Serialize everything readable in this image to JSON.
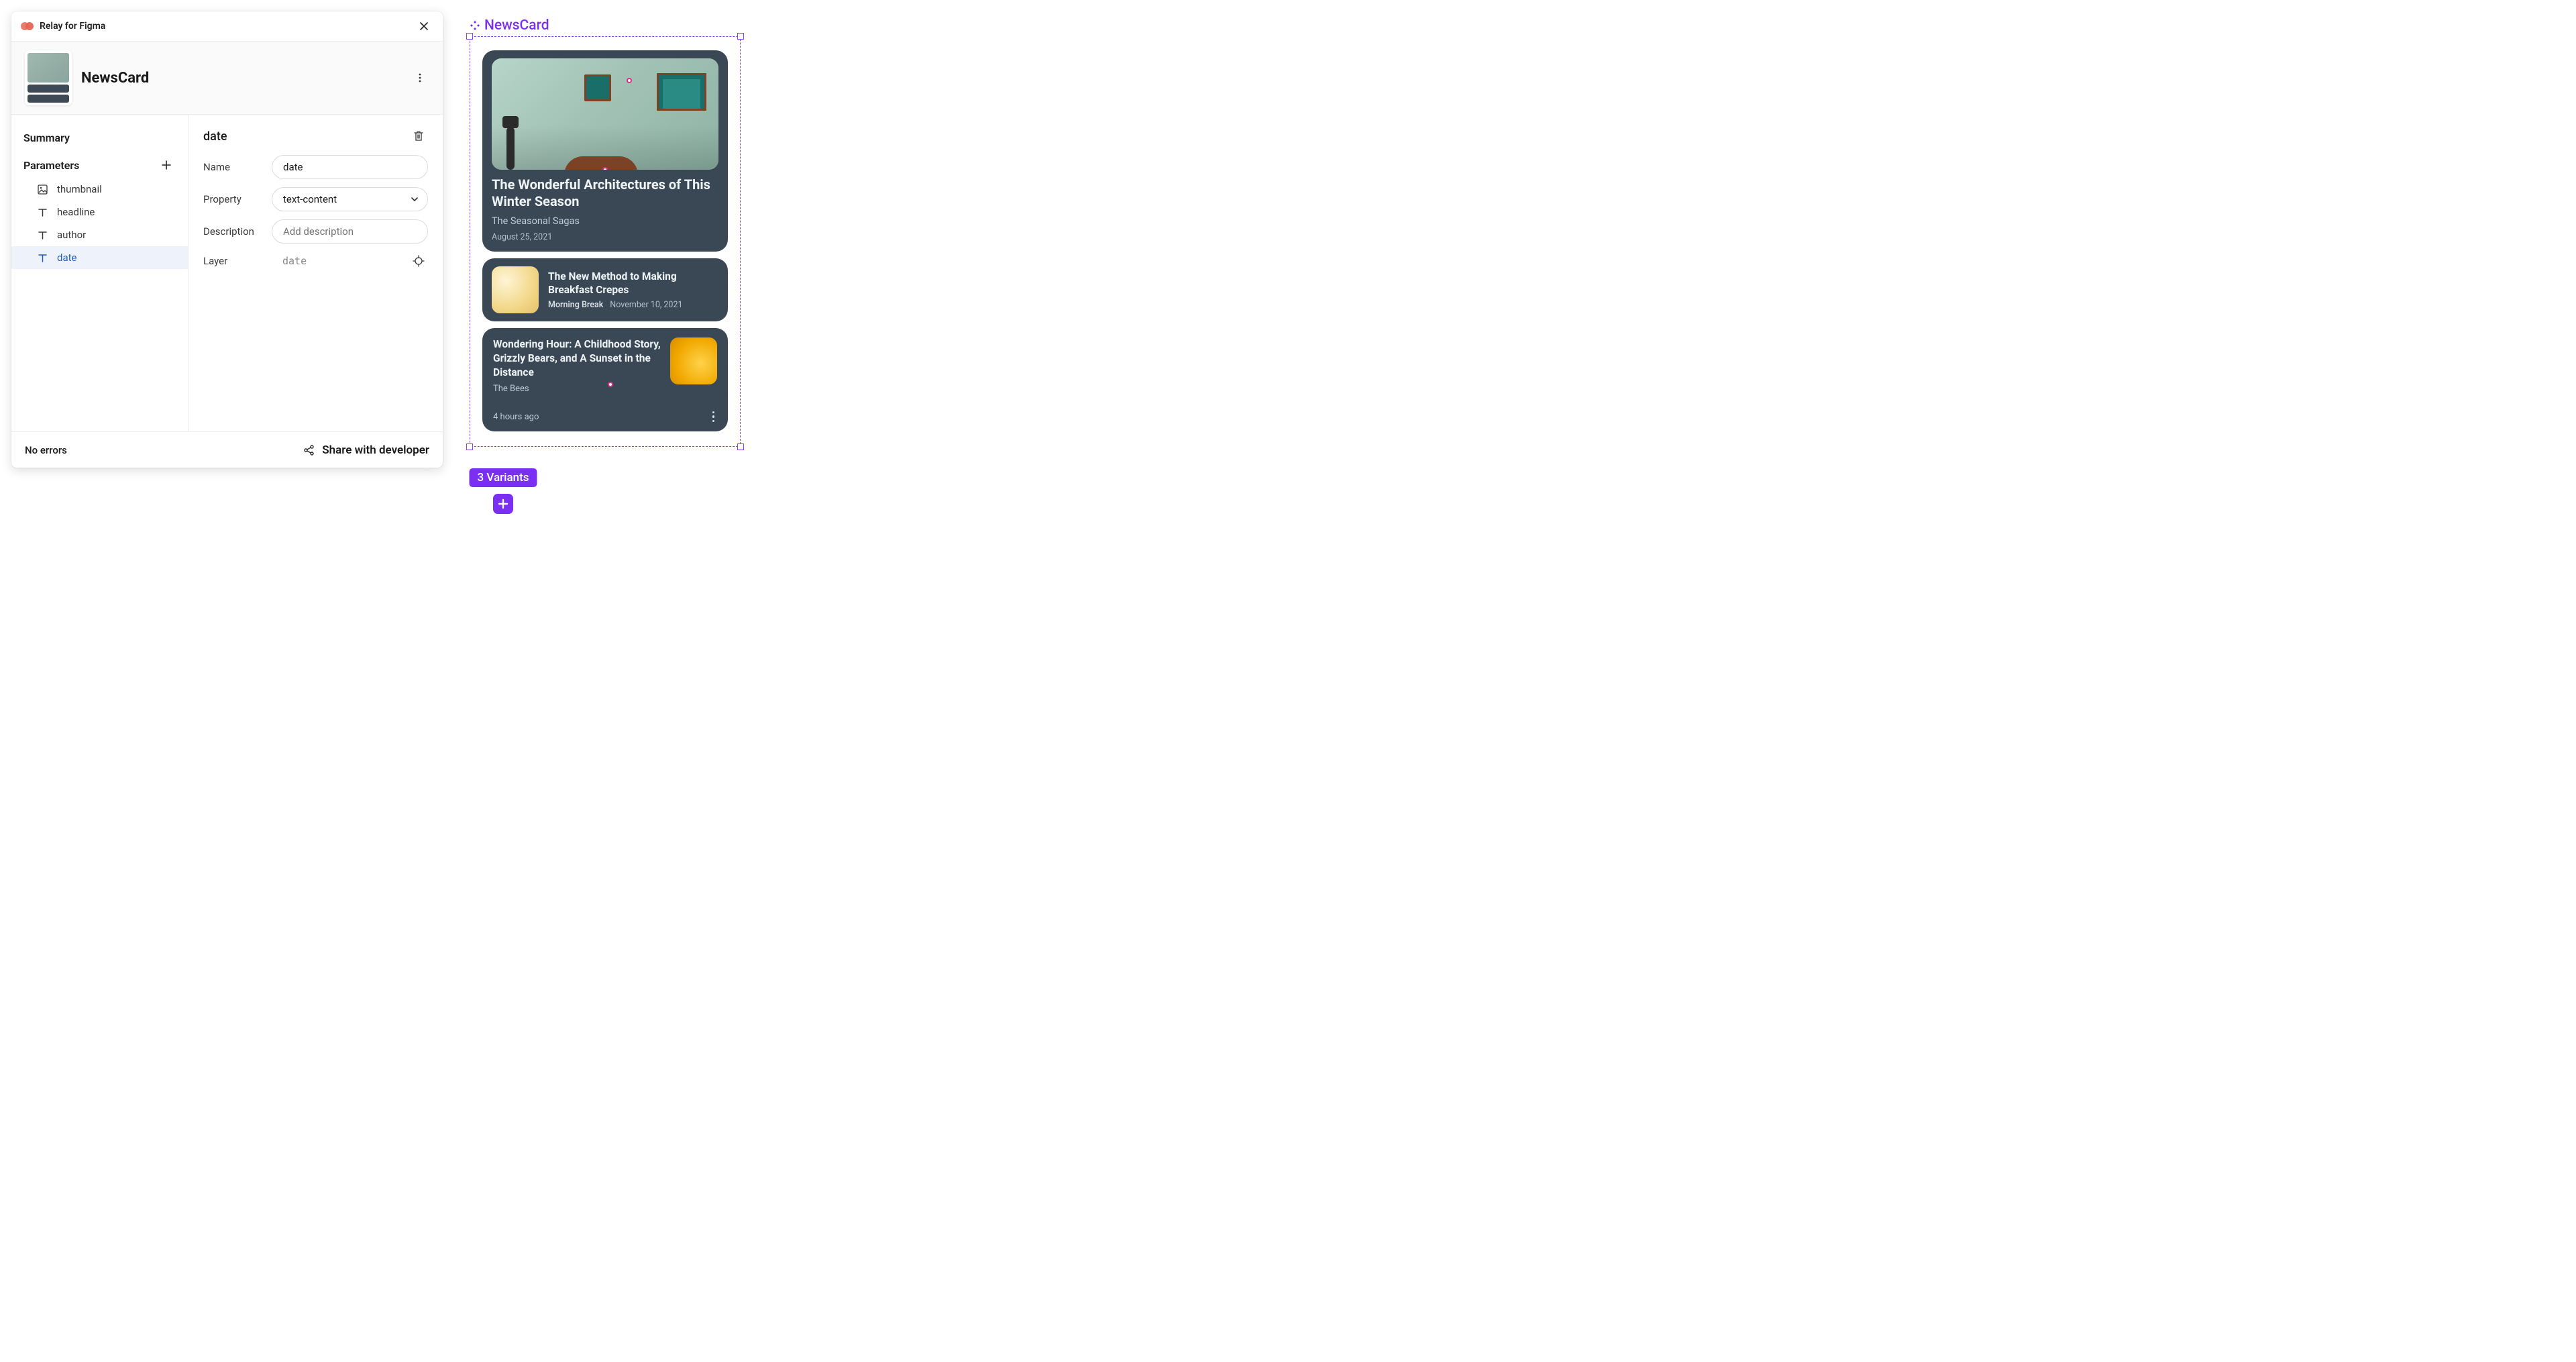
{
  "plugin": {
    "name": "Relay for Figma"
  },
  "component": {
    "name": "NewsCard",
    "variants_label": "3 Variants"
  },
  "sidebar": {
    "summary": "Summary",
    "parameters_label": "Parameters",
    "params": [
      {
        "icon": "image",
        "name": "thumbnail",
        "selected": false
      },
      {
        "icon": "text",
        "name": "headline",
        "selected": false
      },
      {
        "icon": "text",
        "name": "author",
        "selected": false
      },
      {
        "icon": "text",
        "name": "date",
        "selected": true
      }
    ]
  },
  "detail": {
    "title": "date",
    "fields": {
      "name_label": "Name",
      "name_value": "date",
      "property_label": "Property",
      "property_value": "text-content",
      "description_label": "Description",
      "description_placeholder": "Add description",
      "layer_label": "Layer",
      "layer_value": "date"
    }
  },
  "footer": {
    "errors": "No errors",
    "share": "Share with developer"
  },
  "cards": [
    {
      "headline": "The Wonderful Architectures of This Winter Season",
      "author": "The Seasonal Sagas",
      "date": "August 25, 2021"
    },
    {
      "headline": "The New Method to Making Breakfast Crepes",
      "author": "Morning Break",
      "date": "November 10, 2021"
    },
    {
      "headline": "Wondering Hour: A Childhood Story, Grizzly Bears, and A Sunset in the Distance",
      "author": "The Bees",
      "date": "4 hours ago"
    }
  ]
}
